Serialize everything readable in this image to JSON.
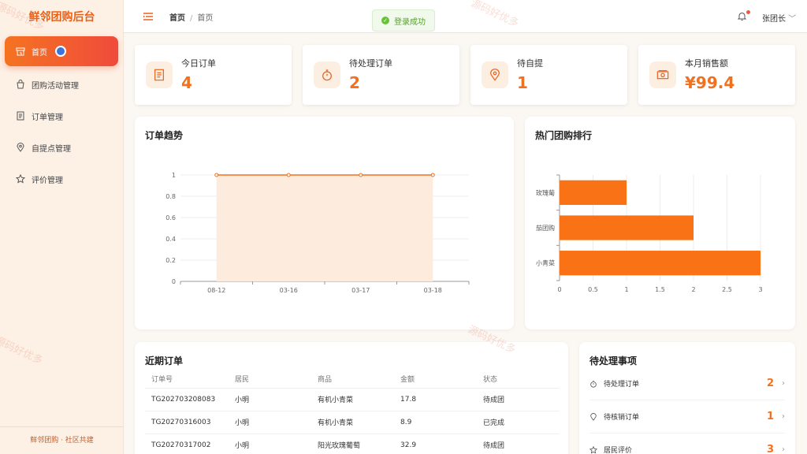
{
  "app": {
    "brand": "鲜邻团购后台",
    "footer": "鲜邻团购 · 社区共建"
  },
  "sidebar": {
    "items": [
      {
        "label": "首页",
        "icon": "storefront-icon",
        "active": true
      },
      {
        "label": "团购活动管理",
        "icon": "bag-icon"
      },
      {
        "label": "订单管理",
        "icon": "document-icon"
      },
      {
        "label": "自提点管理",
        "icon": "location-pin-icon"
      },
      {
        "label": "评价管理",
        "icon": "star-icon"
      }
    ]
  },
  "header": {
    "breadcrumb": [
      "首页",
      "首页"
    ],
    "toast": "登录成功",
    "user": "张团长"
  },
  "stats": [
    {
      "label": "今日订单",
      "value": "4",
      "icon": "document-icon"
    },
    {
      "label": "待处理订单",
      "value": "2",
      "icon": "stopwatch-icon"
    },
    {
      "label": "待自提",
      "value": "1",
      "icon": "location-pin-icon"
    },
    {
      "label": "本月销售额",
      "value": "¥99.4",
      "icon": "money-icon"
    }
  ],
  "trend": {
    "title": "订单趋势"
  },
  "ranking": {
    "title": "热门团购排行"
  },
  "orders": {
    "title": "近期订单",
    "columns": [
      "订单号",
      "居民",
      "商品",
      "金额",
      "状态"
    ],
    "rows": [
      [
        "TG202703208083",
        "小明",
        "有机小青菜",
        "17.8",
        "待成团"
      ],
      [
        "TG20270316003",
        "小明",
        "有机小青菜",
        "8.9",
        "已完成"
      ],
      [
        "TG20270317002",
        "小明",
        "阳光玫瑰葡萄",
        "32.9",
        "待成团"
      ]
    ]
  },
  "todos": {
    "title": "待处理事项",
    "items": [
      {
        "label": "待处理订单",
        "count": "2",
        "icon": "stopwatch-icon"
      },
      {
        "label": "待核销订单",
        "count": "1",
        "icon": "location-pin-icon"
      },
      {
        "label": "居民评价",
        "count": "3",
        "icon": "star-icon"
      }
    ]
  },
  "watermark": "源码好优多",
  "colors": {
    "accent": "#f07120",
    "bar": "#f97316",
    "area": "#fdebdd"
  },
  "chart_data": [
    {
      "type": "line",
      "x": [
        "08-12",
        "03-16",
        "03-17",
        "03-18"
      ],
      "series": [
        {
          "values": [
            1,
            1,
            1,
            1
          ]
        }
      ],
      "ylim": [
        0,
        1
      ],
      "yticks": [
        "0",
        "0.2",
        "0.4",
        "0.6",
        "0.8",
        "1"
      ],
      "area_fill": true,
      "grid": true
    },
    {
      "type": "bar",
      "orientation": "horizontal",
      "categories": [
        "玫瑰葡",
        "茄团购",
        "小青菜"
      ],
      "values": [
        1,
        2,
        3
      ],
      "xlim": [
        0,
        3
      ],
      "xticks": [
        "0",
        "0.5",
        "1",
        "1.5",
        "2",
        "2.5",
        "3"
      ],
      "grid": true
    }
  ]
}
